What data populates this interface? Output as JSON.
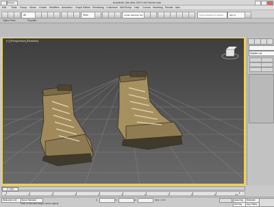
{
  "window": {
    "app_title": "Autodesk 3ds Max  2014 x64     Boots.max",
    "workspace": "Default"
  },
  "menus": [
    "Edit",
    "Tools",
    "Group",
    "Views",
    "Create",
    "Modifiers",
    "Animation",
    "Graph Editors",
    "Rendering",
    "Customize",
    "MAXScript",
    "Help",
    "Corona",
    "Modeling",
    "Render",
    "Max"
  ],
  "toolbar": {
    "filter": "All",
    "view": "View",
    "selection_set": "Create Selection Set",
    "search_text": "Type a keyword or phrase",
    "user_button": "Sign In"
  },
  "ribbon": {
    "tabs": [
      "Object Paint",
      "Populate"
    ]
  },
  "viewport": {
    "label": "[+] [Perspective] [Realistic]",
    "highlight_color": "#f0d24a"
  },
  "command_panel": {
    "object_name": "",
    "modifier_list": "Modifier List"
  },
  "timeline": {
    "current": "0 / 100",
    "ticks": [
      "0",
      "10",
      "20",
      "30",
      "40",
      "50",
      "60",
      "70",
      "80",
      "90",
      "100"
    ]
  },
  "status": {
    "welcome": "Welcome to M",
    "selected": "None Selected",
    "prompt": "Click or click-and-drag to select objects",
    "x_label": "X:",
    "y_label": "Y:",
    "z_label": "Z:",
    "grid": "Grid = 10.0",
    "auto_key": "Auto Key",
    "set_key": "Set Key",
    "selected_dd": "Selected",
    "key_filters": "Key Filters..."
  }
}
